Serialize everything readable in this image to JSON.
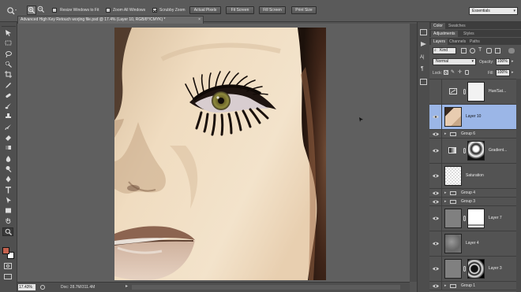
{
  "options_bar": {
    "resize_windows_to_fit": "Resize Windows to Fit",
    "zoom_all_windows": "Zoom All Windows",
    "scrubby_zoom": "Scrubby Zoom",
    "actual_pixels": "Actual Pixels",
    "fit_screen": "Fit Screen",
    "fill_screen": "Fill Screen",
    "print_size": "Print Size",
    "workspace": "Essentials"
  },
  "document": {
    "tab_title": "Advanced High Key Retouch worjing file.psd @ 17.4% (Layer 10, RGB/8*/CMYK) *",
    "zoom": "17.43%",
    "doc_size": "Doc: 28.7M/311.4M"
  },
  "panels": {
    "color_tabs": [
      "Color",
      "Swatches"
    ],
    "adjust_tabs": [
      "Adjustments",
      "Styles"
    ],
    "layers_tabs": [
      "Layers",
      "Channels",
      "Paths"
    ],
    "kind_filter": "Kind",
    "blend_mode": "Normal",
    "opacity_label": "Opacity:",
    "opacity_value": "100%",
    "lock_label": "Lock:",
    "fill_label": "Fill:",
    "fill_value": "100%"
  },
  "layers": [
    {
      "name": "Hue/Sat...",
      "kind": "adjustment-mask",
      "visible": false,
      "selected": false
    },
    {
      "name": "Layer 10",
      "kind": "image",
      "visible": true,
      "selected": true
    },
    {
      "name": "Group 6",
      "kind": "group",
      "visible": true,
      "selected": false
    },
    {
      "name": "Gradient...",
      "kind": "gradient-mask",
      "visible": true,
      "selected": false
    },
    {
      "name": "Saturation",
      "kind": "transparent",
      "visible": true,
      "selected": false
    },
    {
      "name": "Group 4",
      "kind": "group",
      "visible": true,
      "selected": false
    },
    {
      "name": "Group 3",
      "kind": "group",
      "visible": true,
      "selected": false
    },
    {
      "name": "Layer 7",
      "kind": "gray-mask",
      "visible": true,
      "selected": false
    },
    {
      "name": "Layer 4",
      "kind": "texture",
      "visible": true,
      "selected": false
    },
    {
      "name": "Layer 3",
      "kind": "bw-mask",
      "visible": true,
      "selected": false
    },
    {
      "name": "Group 1",
      "kind": "group",
      "visible": true,
      "selected": false
    }
  ],
  "colors": {
    "foreground": "#c4624e",
    "background": "#ffffff",
    "selection": "#9bb6e7"
  },
  "tool_icons": [
    "move-icon",
    "marquee-icon",
    "lasso-icon",
    "quick-select-icon",
    "crop-icon",
    "eyedropper-icon",
    "healing-brush-icon",
    "brush-icon",
    "clone-stamp-icon",
    "history-brush-icon",
    "eraser-icon",
    "gradient-icon",
    "blur-icon",
    "dodge-icon",
    "pen-icon",
    "type-icon",
    "path-select-icon",
    "shape-icon",
    "hand-icon",
    "zoom-icon"
  ]
}
